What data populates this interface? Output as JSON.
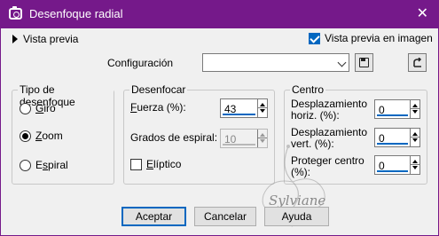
{
  "window": {
    "title": "Desenfoque radial",
    "close_glyph": "✕"
  },
  "preview": {
    "toggle_label": "Vista previa",
    "checkbox_label": "Vista previa en imagen",
    "checked": true
  },
  "config": {
    "label": "Configuración",
    "value": ""
  },
  "blur_type": {
    "legend": "Tipo de desenfoque",
    "options": [
      {
        "label_pre": "",
        "label_u": "G",
        "label_post": "iro",
        "checked": false
      },
      {
        "label_pre": "",
        "label_u": "Z",
        "label_post": "oom",
        "checked": true
      },
      {
        "label_pre": "E",
        "label_u": "s",
        "label_post": "piral",
        "checked": false
      }
    ]
  },
  "blur": {
    "legend": "Desenfocar",
    "strength_label_u": "F",
    "strength_label_post": "uerza (%):",
    "strength_value": "43",
    "spiral_label_pre": "Grados de espiral:",
    "spiral_value": "10",
    "elliptic_label_u": "E",
    "elliptic_label_post": "líptico",
    "elliptic_checked": false
  },
  "center": {
    "legend": "Centro",
    "hoffset_label_line1": "Desplazamiento",
    "hoffset_label_line2": "horiz. (%):",
    "hoffset_value": "0",
    "voffset_label_line1": "Desplazamiento",
    "voffset_label_line2": "vert. (%):",
    "voffset_value": "0",
    "protect_label_line1": "Proteger centro",
    "protect_label_line2": "(%):",
    "protect_value": "0"
  },
  "buttons": {
    "accept": "Aceptar",
    "cancel": "Cancelar",
    "help": "Ayuda"
  },
  "watermark": "Sylviane",
  "colors": {
    "titlebar": "#75198a",
    "accent": "#0067c0"
  }
}
